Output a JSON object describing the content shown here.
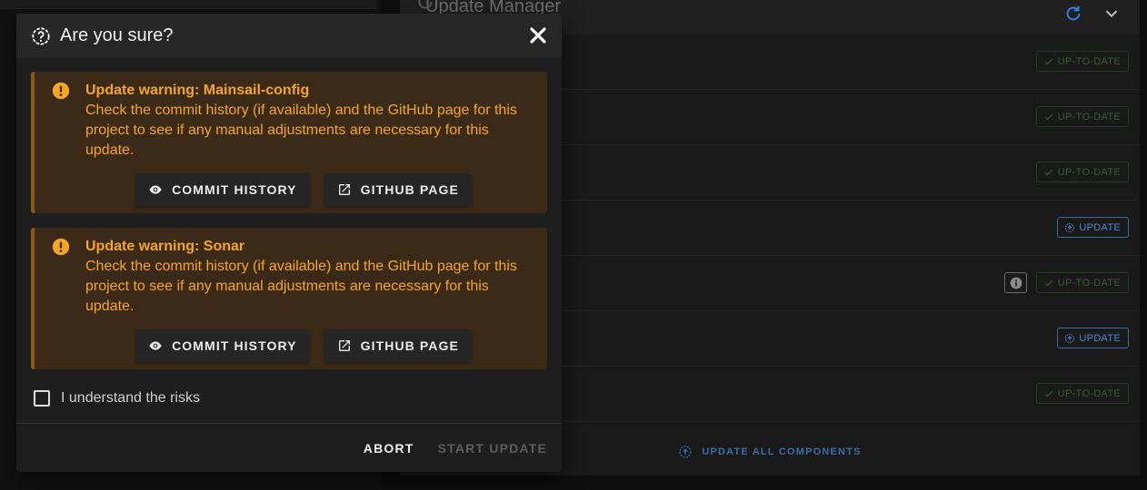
{
  "panel": {
    "title": "Update Manager",
    "rows": [
      {
        "status": "UP-TO-DATE",
        "kind": "ok",
        "info": false
      },
      {
        "status": "UP-TO-DATE",
        "kind": "ok",
        "info": false
      },
      {
        "status": "UP-TO-DATE",
        "kind": "ok",
        "info": false
      },
      {
        "status": "UPDATE",
        "kind": "update",
        "info": false
      },
      {
        "status": "UP-TO-DATE",
        "kind": "ok",
        "info": true
      },
      {
        "status": "UPDATE",
        "kind": "update",
        "info": false
      },
      {
        "status": "UP-TO-DATE",
        "kind": "ok",
        "info": false
      }
    ],
    "update_all_label": "UPDATE ALL COMPONENTS"
  },
  "dialog": {
    "title": "Are you sure?",
    "warnings": [
      {
        "title": "Update warning: Mainsail-config",
        "message": "Check the commit history (if available) and the GitHub page for this project to see if any manual adjustments are necessary for this update.",
        "commit_label": "COMMIT HISTORY",
        "github_label": "GITHUB PAGE"
      },
      {
        "title": "Update warning: Sonar",
        "message": "Check the commit history (if available) and the GitHub page for this project to see if any manual adjustments are necessary for this update.",
        "commit_label": "COMMIT HISTORY",
        "github_label": "GITHUB PAGE"
      }
    ],
    "checkbox_label": "I understand the risks",
    "checkbox_checked": false,
    "abort_label": "ABORT",
    "start_label": "START UPDATE"
  },
  "colors": {
    "warning": "#f5a623",
    "accent_blue": "#4f88cc",
    "ok_green": "#3c5a38"
  }
}
